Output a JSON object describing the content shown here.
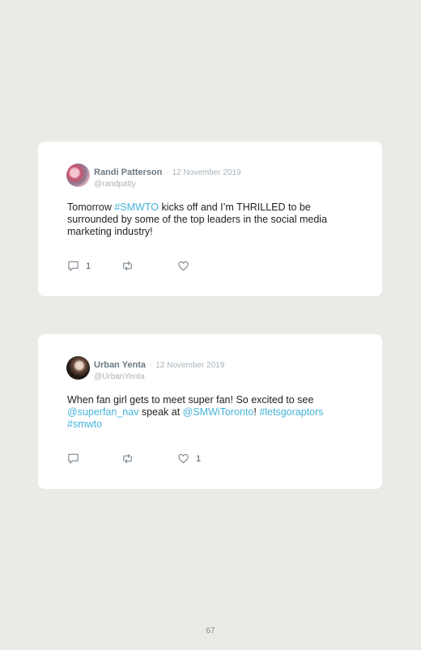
{
  "tweets": [
    {
      "name": "Randi Patterson",
      "separator": "·",
      "date": "12 November 2019",
      "handle": "@randpatty",
      "text": {
        "p1": "Tomorrow ",
        "link1": "#SMWTO",
        "p2": " kicks off and I’m THRILLED to be surrounded by some of the top leaders in the social media marketing industry!"
      },
      "reply_count": "1",
      "like_count": ""
    },
    {
      "name": "Urban Yenta",
      "separator": "·",
      "date": "12 November 2019",
      "handle": "@UrbanYenta",
      "text": {
        "p1": "When fan girl gets to meet super fan! So excited to see ",
        "link1": "@superfan_nav",
        "p2": " speak at ",
        "link2": "@SMWiToronto",
        "p3": "! ",
        "link3": "#letsgoraptors",
        "p4": " ",
        "link4": "#smwto"
      },
      "reply_count": "",
      "like_count": "1"
    }
  ],
  "icons": {
    "reply": "comment-icon",
    "retweet": "retweet-icon",
    "like": "heart-icon"
  },
  "colors": {
    "link": "#45b3d9",
    "background": "#e9ebe6",
    "card": "#ffffff"
  },
  "page_number": "67"
}
